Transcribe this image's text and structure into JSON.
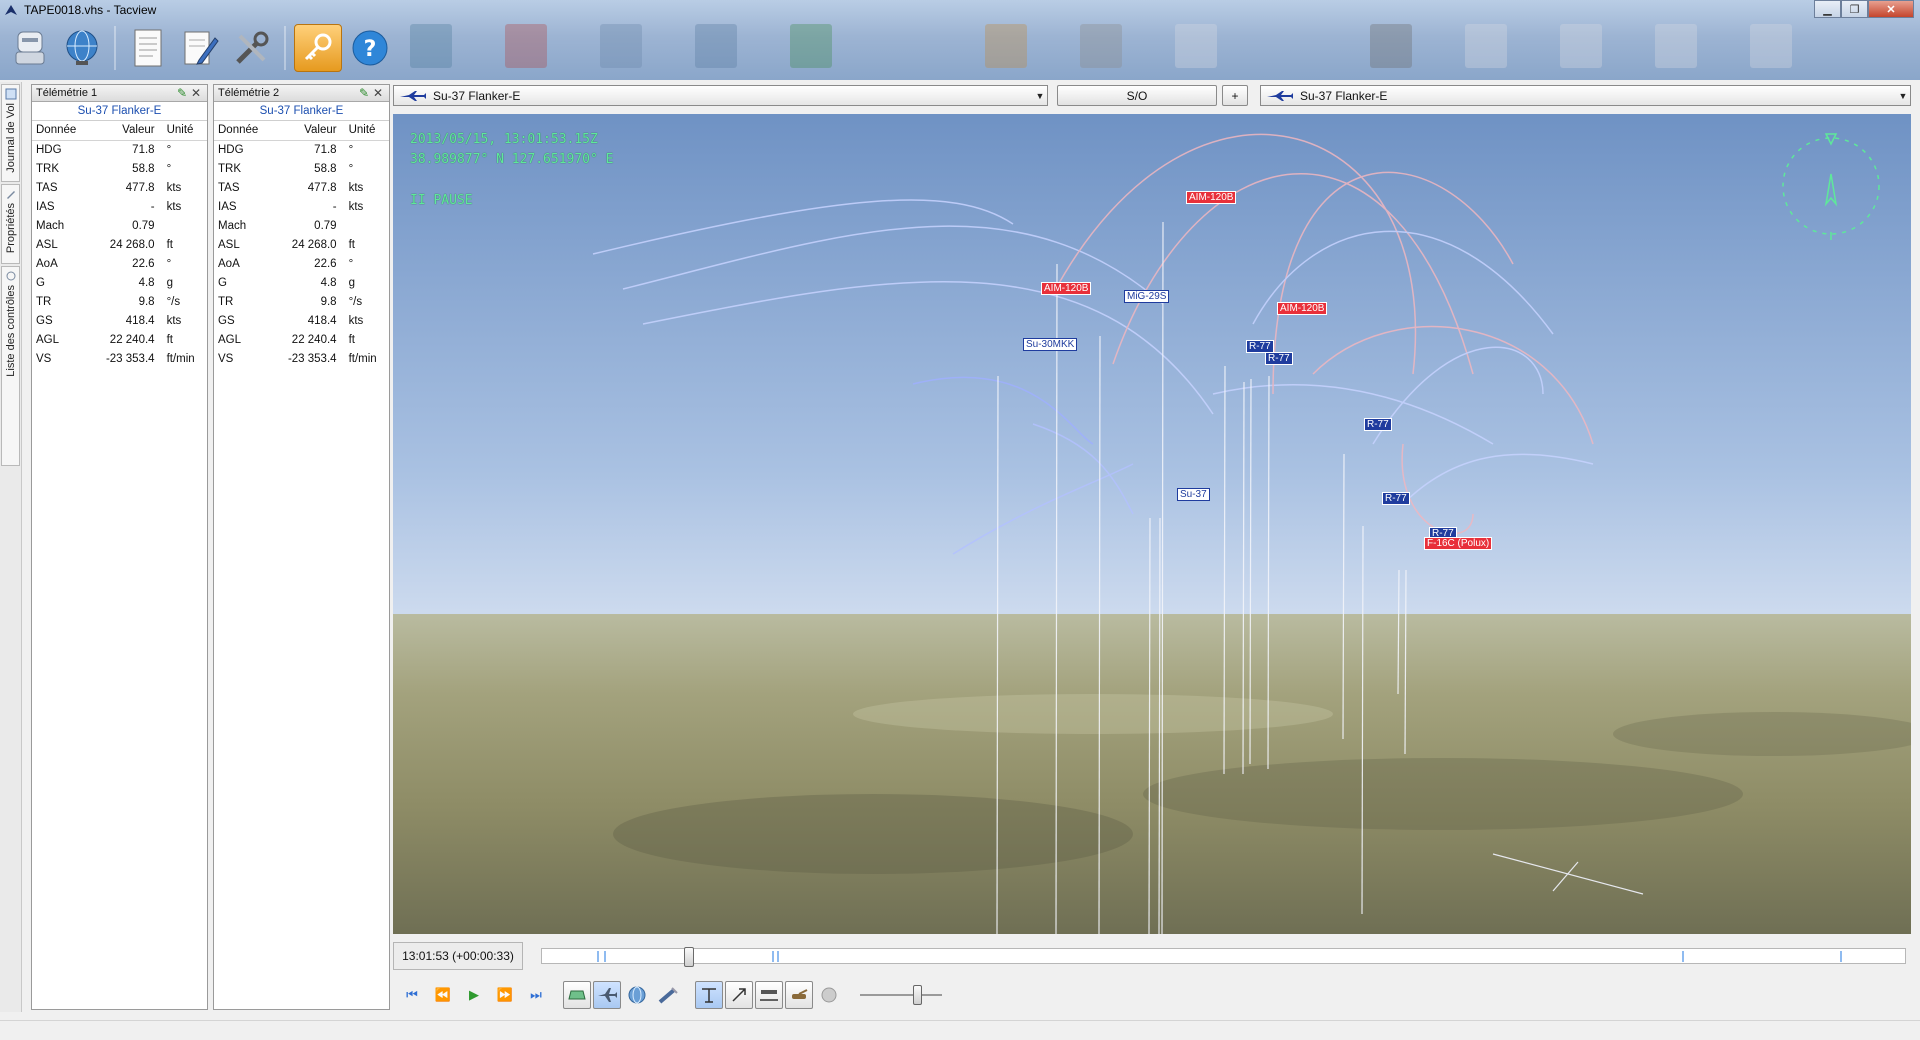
{
  "window": {
    "title": "TAPE0018.vhs - Tacview"
  },
  "toolbar": {
    "buttons": [
      {
        "name": "recorder-icon"
      },
      {
        "name": "globe-icon"
      },
      {
        "name": "document-icon"
      },
      {
        "name": "edit-notes-icon"
      },
      {
        "name": "tools-icon"
      },
      {
        "name": "key-icon"
      },
      {
        "name": "help-icon"
      }
    ]
  },
  "side_tabs": [
    "Journal de Vol",
    "Propriétés",
    "Liste des contrôles"
  ],
  "telemetry": [
    {
      "title": "Télémétrie 1",
      "object": "Su-37 Flanker-E",
      "headers": [
        "Donnée",
        "Valeur",
        "Unité"
      ],
      "rows": [
        [
          "HDG",
          "71.8",
          "°"
        ],
        [
          "TRK",
          "58.8",
          "°"
        ],
        [
          "TAS",
          "477.8",
          "kts"
        ],
        [
          "IAS",
          "-",
          "kts"
        ],
        [
          "Mach",
          "0.79",
          ""
        ],
        [
          "ASL",
          "24 268.0",
          "ft"
        ],
        [
          "AoA",
          "22.6",
          "°"
        ],
        [
          "G",
          "4.8",
          "g"
        ],
        [
          "TR",
          "9.8",
          "°/s"
        ],
        [
          "GS",
          "418.4",
          "kts"
        ],
        [
          "AGL",
          "22 240.4",
          "ft"
        ],
        [
          "VS",
          "-23 353.4",
          "ft/min"
        ]
      ]
    },
    {
      "title": "Télémétrie 2",
      "object": "Su-37 Flanker-E",
      "headers": [
        "Donnée",
        "Valeur",
        "Unité"
      ],
      "rows": [
        [
          "HDG",
          "71.8",
          "°"
        ],
        [
          "TRK",
          "58.8",
          "°"
        ],
        [
          "TAS",
          "477.8",
          "kts"
        ],
        [
          "IAS",
          "-",
          "kts"
        ],
        [
          "Mach",
          "0.79",
          ""
        ],
        [
          "ASL",
          "24 268.0",
          "ft"
        ],
        [
          "AoA",
          "22.6",
          "°"
        ],
        [
          "G",
          "4.8",
          "g"
        ],
        [
          "TR",
          "9.8",
          "°/s"
        ],
        [
          "GS",
          "418.4",
          "kts"
        ],
        [
          "AGL",
          "22 240.4",
          "ft"
        ],
        [
          "VS",
          "-23 353.4",
          "ft/min"
        ]
      ]
    }
  ],
  "viewbar": {
    "primary_object": "Su-37 Flanker-E",
    "so_label": "S/O",
    "plus_label": "+",
    "secondary_object": "Su-37 Flanker-E"
  },
  "hud": {
    "datetime": "2013/05/15, 13:01:53.15Z",
    "coords": "38.989877° N  127.651970° E",
    "pause": "II PAUSE"
  },
  "labels": [
    {
      "text": "AIM-120B",
      "color": "red"
    },
    {
      "text": "AIM-120B",
      "color": "red"
    },
    {
      "text": "MiG-29S",
      "color": "white"
    },
    {
      "text": "AIM-120B",
      "color": "red"
    },
    {
      "text": "Su-30MKK",
      "color": "white"
    },
    {
      "text": "R-77",
      "color": "blue"
    },
    {
      "text": "R-77",
      "color": "blue"
    },
    {
      "text": "R-77",
      "color": "blue"
    },
    {
      "text": "Su-37",
      "color": "white"
    },
    {
      "text": "R-77",
      "color": "blue"
    },
    {
      "text": "R-77",
      "color": "blue"
    },
    {
      "text": "F-16C (Polux)",
      "color": "red"
    }
  ],
  "playback": {
    "time": "13:01:53 (+00:00:33)",
    "progress": 0.105,
    "speed": 0.72,
    "controls": [
      "skip-start-icon",
      "rewind-icon",
      "play-icon",
      "fast-forward-icon",
      "skip-end-icon"
    ],
    "view_modes": [
      "cockpit-view-icon",
      "external-view-icon",
      "globe-view-icon",
      "satellite-view-icon"
    ],
    "display_toggles": [
      "altitude-lines-icon",
      "labels-icon",
      "ground-objects-icon",
      "ground-units-icon",
      "sound-icon"
    ]
  },
  "colors": {
    "hud_green": "#5ee89a",
    "tag_red": "#e8303a",
    "tag_blue": "#1f3c9e",
    "accent_blue": "#2f6fd4"
  }
}
